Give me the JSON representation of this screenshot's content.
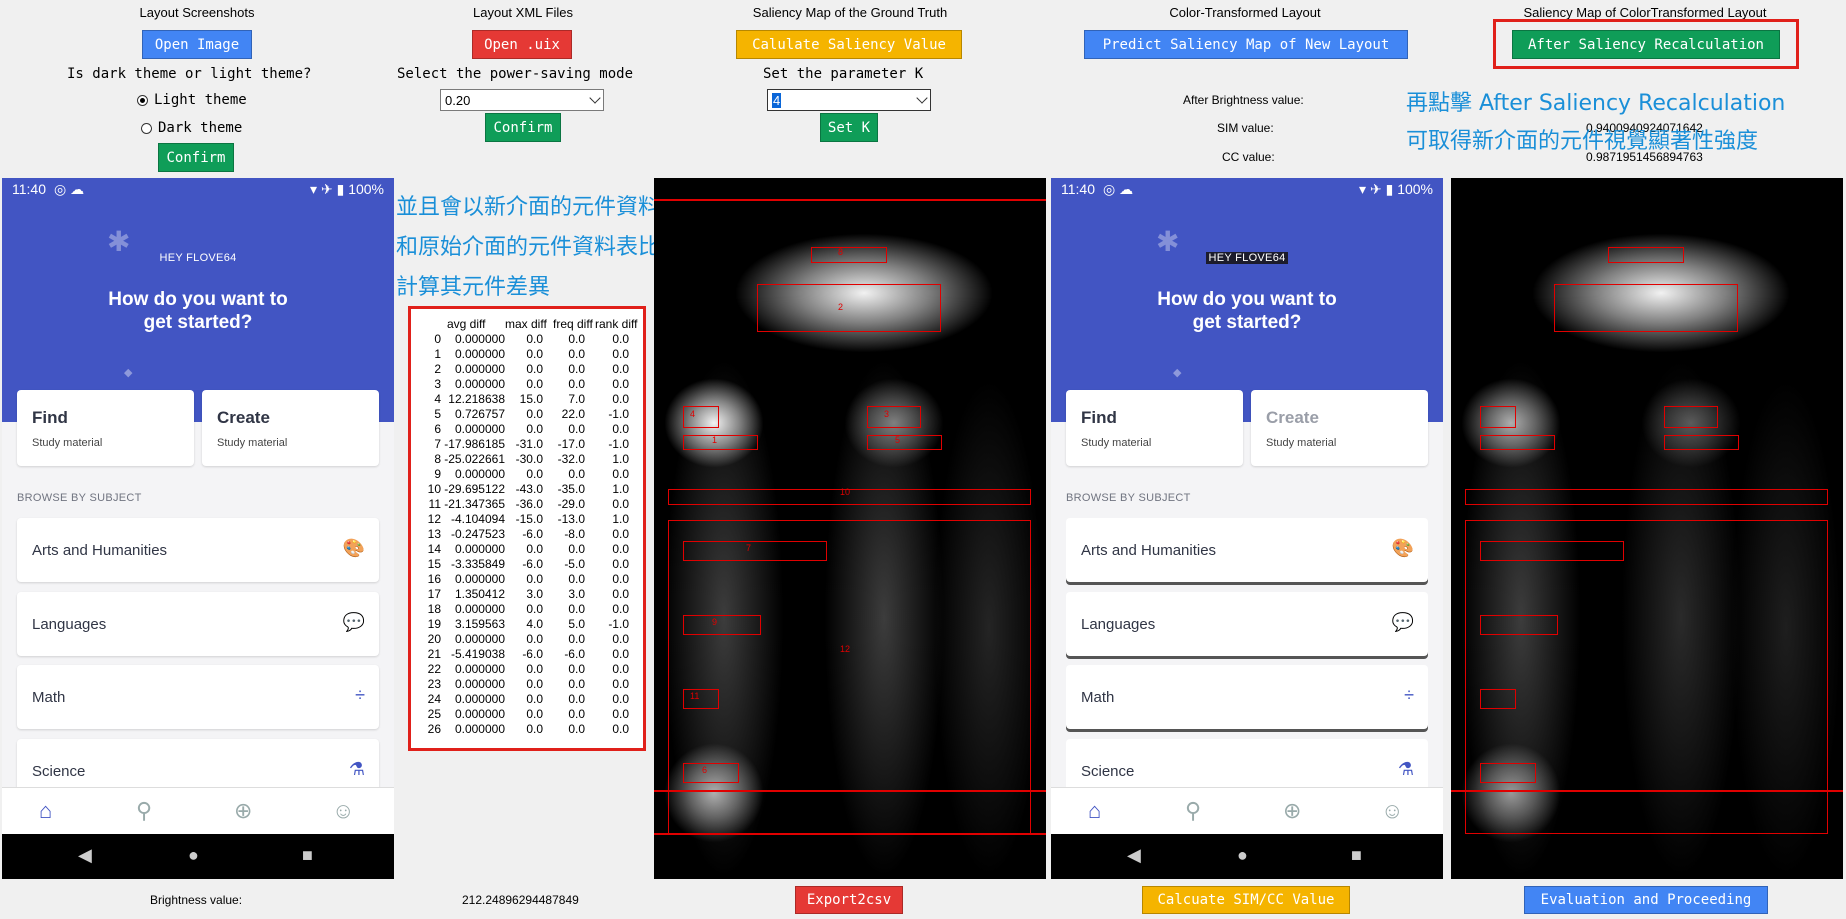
{
  "columns": {
    "c1_title": "Layout Screenshots",
    "c2_title": "Layout XML Files",
    "c3_title": "Saliency Map of the Ground Truth",
    "c4_title": "Color-Transformed Layout",
    "c5_title": "Saliency Map of ColorTransformed Layout"
  },
  "buttons": {
    "open_image": "Open Image",
    "open_uix": "Open .uix",
    "calc_saliency": "Calulate Saliency Value",
    "predict": "Predict Saliency Map of New Layout",
    "after_recalc": "After Saliency Recalculation",
    "confirm_theme": "Confirm",
    "confirm_mode": "Confirm",
    "set_k": "Set K",
    "export": "Export2csv",
    "calc_sim": "Calcuate SIM/CC Value",
    "evaluate": "Evaluation and Proceeding"
  },
  "theme": {
    "question": "Is dark theme or light theme?",
    "light": "Light theme",
    "dark": "Dark theme"
  },
  "power": {
    "label": "Select the power-saving mode",
    "value": "0.20"
  },
  "k_param": {
    "label": "Set the parameter K",
    "value": "4"
  },
  "metrics": {
    "after_brightness_label": "After Brightness value:",
    "sim_label": "SIM value:",
    "sim_value": "0.9400940924071642",
    "cc_label": "CC value:",
    "cc_value": "0.9871951456894763",
    "brightness_label": "Brightness value:",
    "brightness_value": "212.24896294487849"
  },
  "annotations": {
    "right_line1": "再點擊 After Saliency Recalculation",
    "right_line2": "可取得新介面的元件視覺顯著性強度",
    "mid_line1": "並且會以新介面的元件資料表",
    "mid_line2": "和原始介面的元件資料表比對，",
    "mid_line3": "計算其元件差異"
  },
  "phone": {
    "time": "11:40",
    "battery": "100%",
    "greeting": "HEY FLOVE64",
    "question_line1": "How do you want to",
    "question_line2": "get started?",
    "find_title": "Find",
    "find_sub": "Study material",
    "create_title": "Create",
    "create_sub": "Study material",
    "browse": "BROWSE BY SUBJECT",
    "subjects": [
      "Arts and Humanities",
      "Languages",
      "Math",
      "Science"
    ]
  },
  "diff_table": {
    "headers": [
      "avg diff",
      "max diff",
      "freq diff",
      "rank diff"
    ],
    "rows": [
      [
        "0",
        "0.000000",
        "0.0",
        "0.0",
        "0.0"
      ],
      [
        "1",
        "0.000000",
        "0.0",
        "0.0",
        "0.0"
      ],
      [
        "2",
        "0.000000",
        "0.0",
        "0.0",
        "0.0"
      ],
      [
        "3",
        "0.000000",
        "0.0",
        "0.0",
        "0.0"
      ],
      [
        "4",
        "12.218638",
        "15.0",
        "7.0",
        "0.0"
      ],
      [
        "5",
        "0.726757",
        "0.0",
        "22.0",
        "-1.0"
      ],
      [
        "6",
        "0.000000",
        "0.0",
        "0.0",
        "0.0"
      ],
      [
        "7",
        "-17.986185",
        "-31.0",
        "-17.0",
        "-1.0"
      ],
      [
        "8",
        "-25.022661",
        "-30.0",
        "-32.0",
        "1.0"
      ],
      [
        "9",
        "0.000000",
        "0.0",
        "0.0",
        "0.0"
      ],
      [
        "10",
        "-29.695122",
        "-43.0",
        "-35.0",
        "1.0"
      ],
      [
        "11",
        "-21.347365",
        "-36.0",
        "-29.0",
        "0.0"
      ],
      [
        "12",
        "-4.104094",
        "-15.0",
        "-13.0",
        "1.0"
      ],
      [
        "13",
        "-0.247523",
        "-6.0",
        "-8.0",
        "0.0"
      ],
      [
        "14",
        "0.000000",
        "0.0",
        "0.0",
        "0.0"
      ],
      [
        "15",
        "-3.335849",
        "-6.0",
        "-5.0",
        "0.0"
      ],
      [
        "16",
        "0.000000",
        "0.0",
        "0.0",
        "0.0"
      ],
      [
        "17",
        "1.350412",
        "3.0",
        "3.0",
        "0.0"
      ],
      [
        "18",
        "0.000000",
        "0.0",
        "0.0",
        "0.0"
      ],
      [
        "19",
        "3.159563",
        "4.0",
        "5.0",
        "-1.0"
      ],
      [
        "20",
        "0.000000",
        "0.0",
        "0.0",
        "0.0"
      ],
      [
        "21",
        "-5.419038",
        "-6.0",
        "-6.0",
        "0.0"
      ],
      [
        "22",
        "0.000000",
        "0.0",
        "0.0",
        "0.0"
      ],
      [
        "23",
        "0.000000",
        "0.0",
        "0.0",
        "0.0"
      ],
      [
        "24",
        "0.000000",
        "0.0",
        "0.0",
        "0.0"
      ],
      [
        "25",
        "0.000000",
        "0.0",
        "0.0",
        "0.0"
      ],
      [
        "26",
        "0.000000",
        "0.0",
        "0.0",
        "0.0"
      ]
    ]
  },
  "saliency_labels": [
    "8",
    "2",
    "4",
    "1",
    "3",
    "5",
    "10",
    "7",
    "9",
    "12",
    "11",
    "6"
  ],
  "icons": {
    "arts": "palette-icon",
    "languages": "chat-icon",
    "math": "divide-icon",
    "science": "flask-icon"
  }
}
